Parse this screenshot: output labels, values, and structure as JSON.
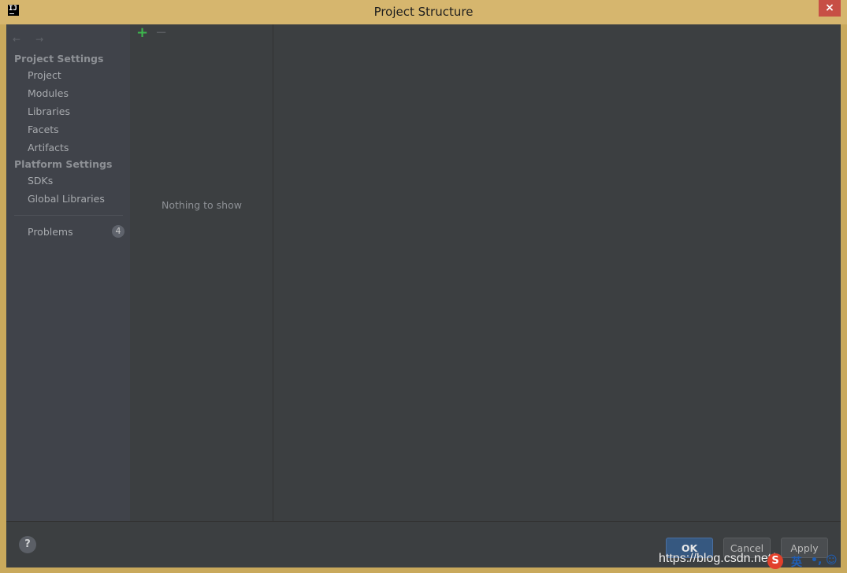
{
  "window": {
    "title": "Project Structure",
    "app_icon_label": "IJ",
    "close_label": "×"
  },
  "sidebar": {
    "back_icon": "←",
    "forward_icon": "→",
    "sections": [
      {
        "title": "Project Settings",
        "items": [
          "Project",
          "Modules",
          "Libraries",
          "Facets",
          "Artifacts"
        ]
      },
      {
        "title": "Platform Settings",
        "items": [
          "SDKs",
          "Global Libraries"
        ]
      }
    ],
    "problems": {
      "label": "Problems",
      "count": "4"
    }
  },
  "list_panel": {
    "add_icon": "+",
    "remove_icon": "−",
    "empty_text": "Nothing to show"
  },
  "footer": {
    "help_label": "?",
    "ok_label": "OK",
    "cancel_label": "Cancel",
    "apply_label": "Apply"
  },
  "overlay": {
    "watermark": "https://blog.csdn.net/",
    "ime_logo": "S",
    "ime_lang": "英",
    "ime_punct": "•,",
    "ime_emoji": "☺"
  }
}
